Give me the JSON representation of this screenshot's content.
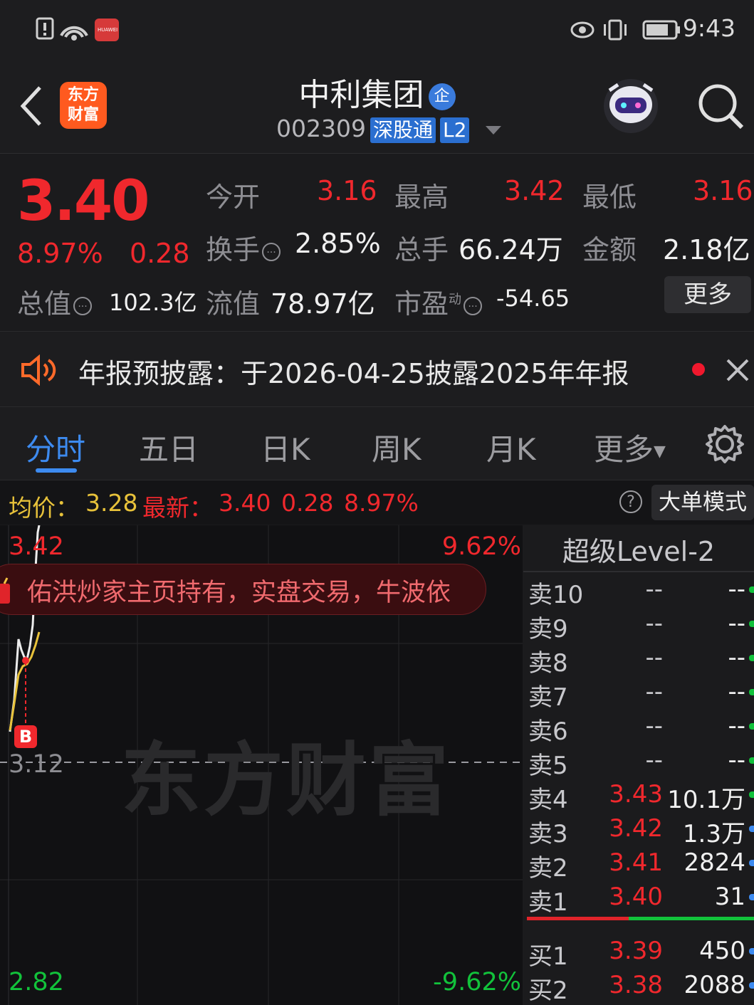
{
  "status_bar": {
    "time": "9:43",
    "carrier_badge": "HUAWEI"
  },
  "header": {
    "back_icon": "chevron-left-icon",
    "logo_line1": "东方",
    "logo_line2": "财富",
    "stock_name": "中利集团",
    "enterprise_badge": "企",
    "stock_code": "002309",
    "tag_connect": "深股通",
    "tag_level": "L2",
    "search_icon": "search-icon"
  },
  "quote": {
    "price": "3.40",
    "change_pct": "8.97%",
    "change_amt": "0.28",
    "open_label": "今开",
    "open": "3.16",
    "high_label": "最高",
    "high": "3.42",
    "low_label": "最低",
    "low": "3.16",
    "turnover_label": "换手",
    "turnover": "2.85%",
    "volume_label": "总手",
    "volume": "66.24万",
    "amount_label": "金额",
    "amount": "2.18亿",
    "mktcap_label": "总值",
    "mktcap": "102.3亿",
    "float_label": "流值",
    "float_cap": "78.97亿",
    "pe_label": "市盈",
    "pe_sup": "动",
    "pe": "-54.65",
    "more_label": "更多"
  },
  "announcement": {
    "text": "年报预披露：于2026-04-25披露2025年年报"
  },
  "tabs": [
    {
      "label": "分时",
      "active": true
    },
    {
      "label": "五日"
    },
    {
      "label": "日K"
    },
    {
      "label": "周K"
    },
    {
      "label": "月K"
    },
    {
      "label": "更多"
    }
  ],
  "avg_bar": {
    "avg_label": "均价：",
    "avg_value": "3.28",
    "latest_label": "最新：",
    "latest_value": "3.40",
    "latest_change": "0.28",
    "latest_pct": "8.97%",
    "help": "?",
    "mode_label": "大单模式"
  },
  "chart": {
    "top_price": "3.42",
    "top_pct": "9.62%",
    "base_price": "3.12",
    "bottom_price": "2.82",
    "bottom_pct": "-9.62%",
    "watermark": "东方财富",
    "ad_text": "佑洪炒家主页持有，实盘交易，牛波依",
    "buy_marker": "B"
  },
  "order_book": {
    "title": "超级Level-2",
    "asks": [
      {
        "label": "卖10",
        "price": "--",
        "volume": "--"
      },
      {
        "label": "卖9",
        "price": "--",
        "volume": "--"
      },
      {
        "label": "卖8",
        "price": "--",
        "volume": "--"
      },
      {
        "label": "卖7",
        "price": "--",
        "volume": "--"
      },
      {
        "label": "卖6",
        "price": "--",
        "volume": "--"
      },
      {
        "label": "卖5",
        "price": "--",
        "volume": "--"
      },
      {
        "label": "卖4",
        "price": "3.43",
        "volume": "10.1万"
      },
      {
        "label": "卖3",
        "price": "3.42",
        "volume": "1.3万"
      },
      {
        "label": "卖2",
        "price": "3.41",
        "volume": "2824"
      },
      {
        "label": "卖1",
        "price": "3.40",
        "volume": "31"
      }
    ],
    "bids": [
      {
        "label": "买1",
        "price": "3.39",
        "volume": "450"
      },
      {
        "label": "买2",
        "price": "3.38",
        "volume": "2088"
      }
    ]
  },
  "colors": {
    "up": "#f0282d",
    "down": "#12c23b",
    "accent": "#3d8bf0",
    "logo": "#ff5a1f"
  }
}
